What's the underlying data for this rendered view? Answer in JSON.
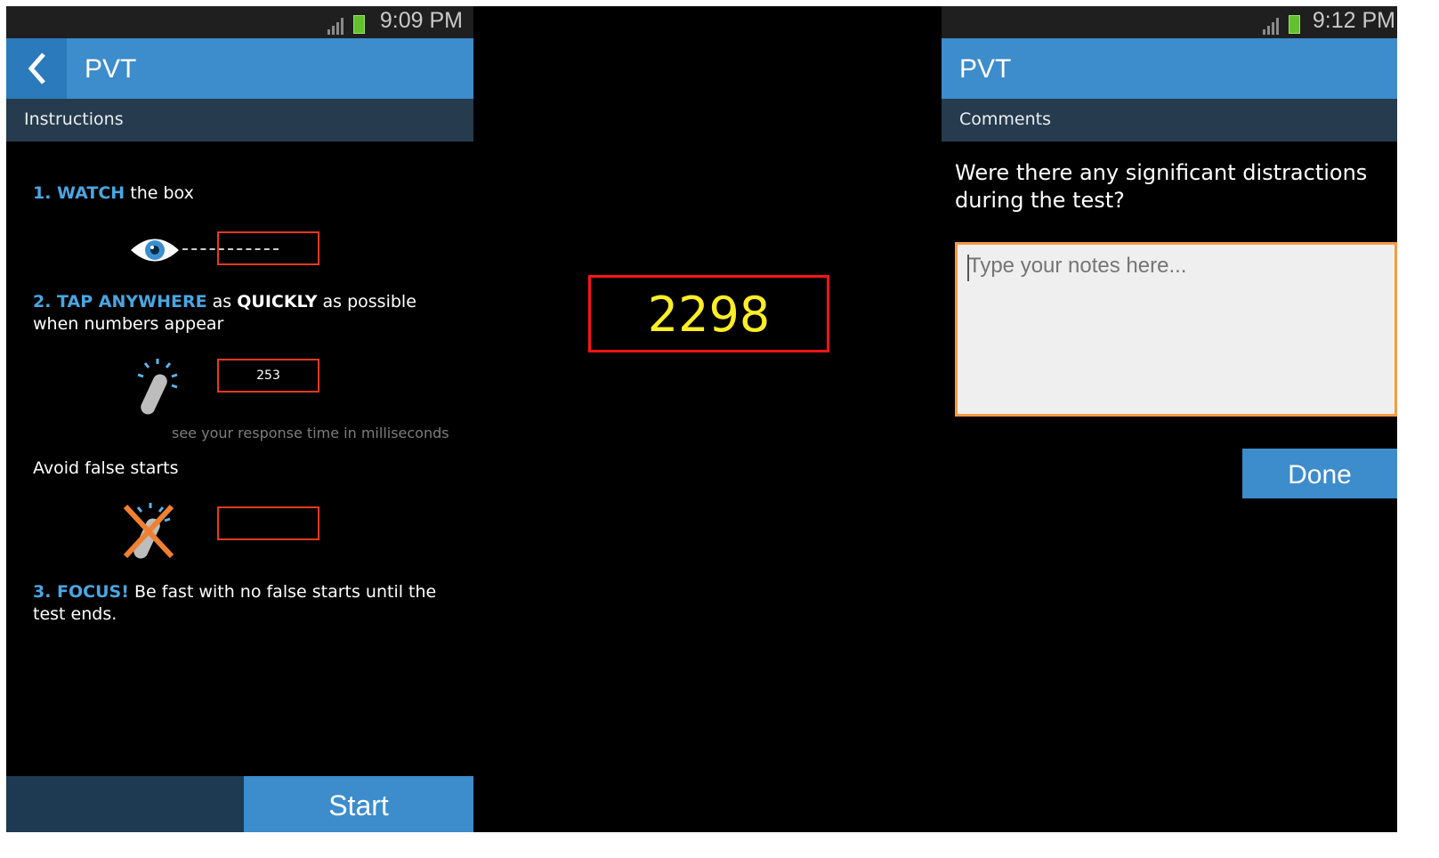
{
  "colors": {
    "accent_blue": "#3d8ccb",
    "subheader": "#263b4d",
    "box_border": "#e53a1e",
    "stimulus_number": "#ffee25",
    "stimulus_border": "#ff1616",
    "input_border": "#f59a45"
  },
  "screen1": {
    "status_time": "9:09 PM",
    "title": "PVT",
    "subtitle": "Instructions",
    "step1": {
      "num_keyword": "1. WATCH",
      "rest": " the box"
    },
    "step2": {
      "keyword": "2. TAP ANYWHERE",
      "mid": " as ",
      "bold": "QUICKLY",
      "rest": " as possible when numbers appear"
    },
    "sample_value": "253",
    "caption": "see your response time in milliseconds",
    "avoid_label": "Avoid false starts",
    "step3": {
      "keyword": "3. FOCUS!",
      "rest": " Be fast with no false starts until the test ends."
    },
    "start_label": "Start",
    "icons": [
      "back-arrow-icon",
      "eye-icon",
      "tap-finger-icon",
      "no-tap-icon",
      "signal-icon",
      "battery-icon"
    ]
  },
  "screen2": {
    "stimulus_value": "2298"
  },
  "screen3": {
    "status_time": "9:12 PM",
    "title": "PVT",
    "subtitle": "Comments",
    "question": "Were there any significant distractions during the test?",
    "notes_placeholder": "Type your notes here...",
    "done_label": "Done"
  }
}
